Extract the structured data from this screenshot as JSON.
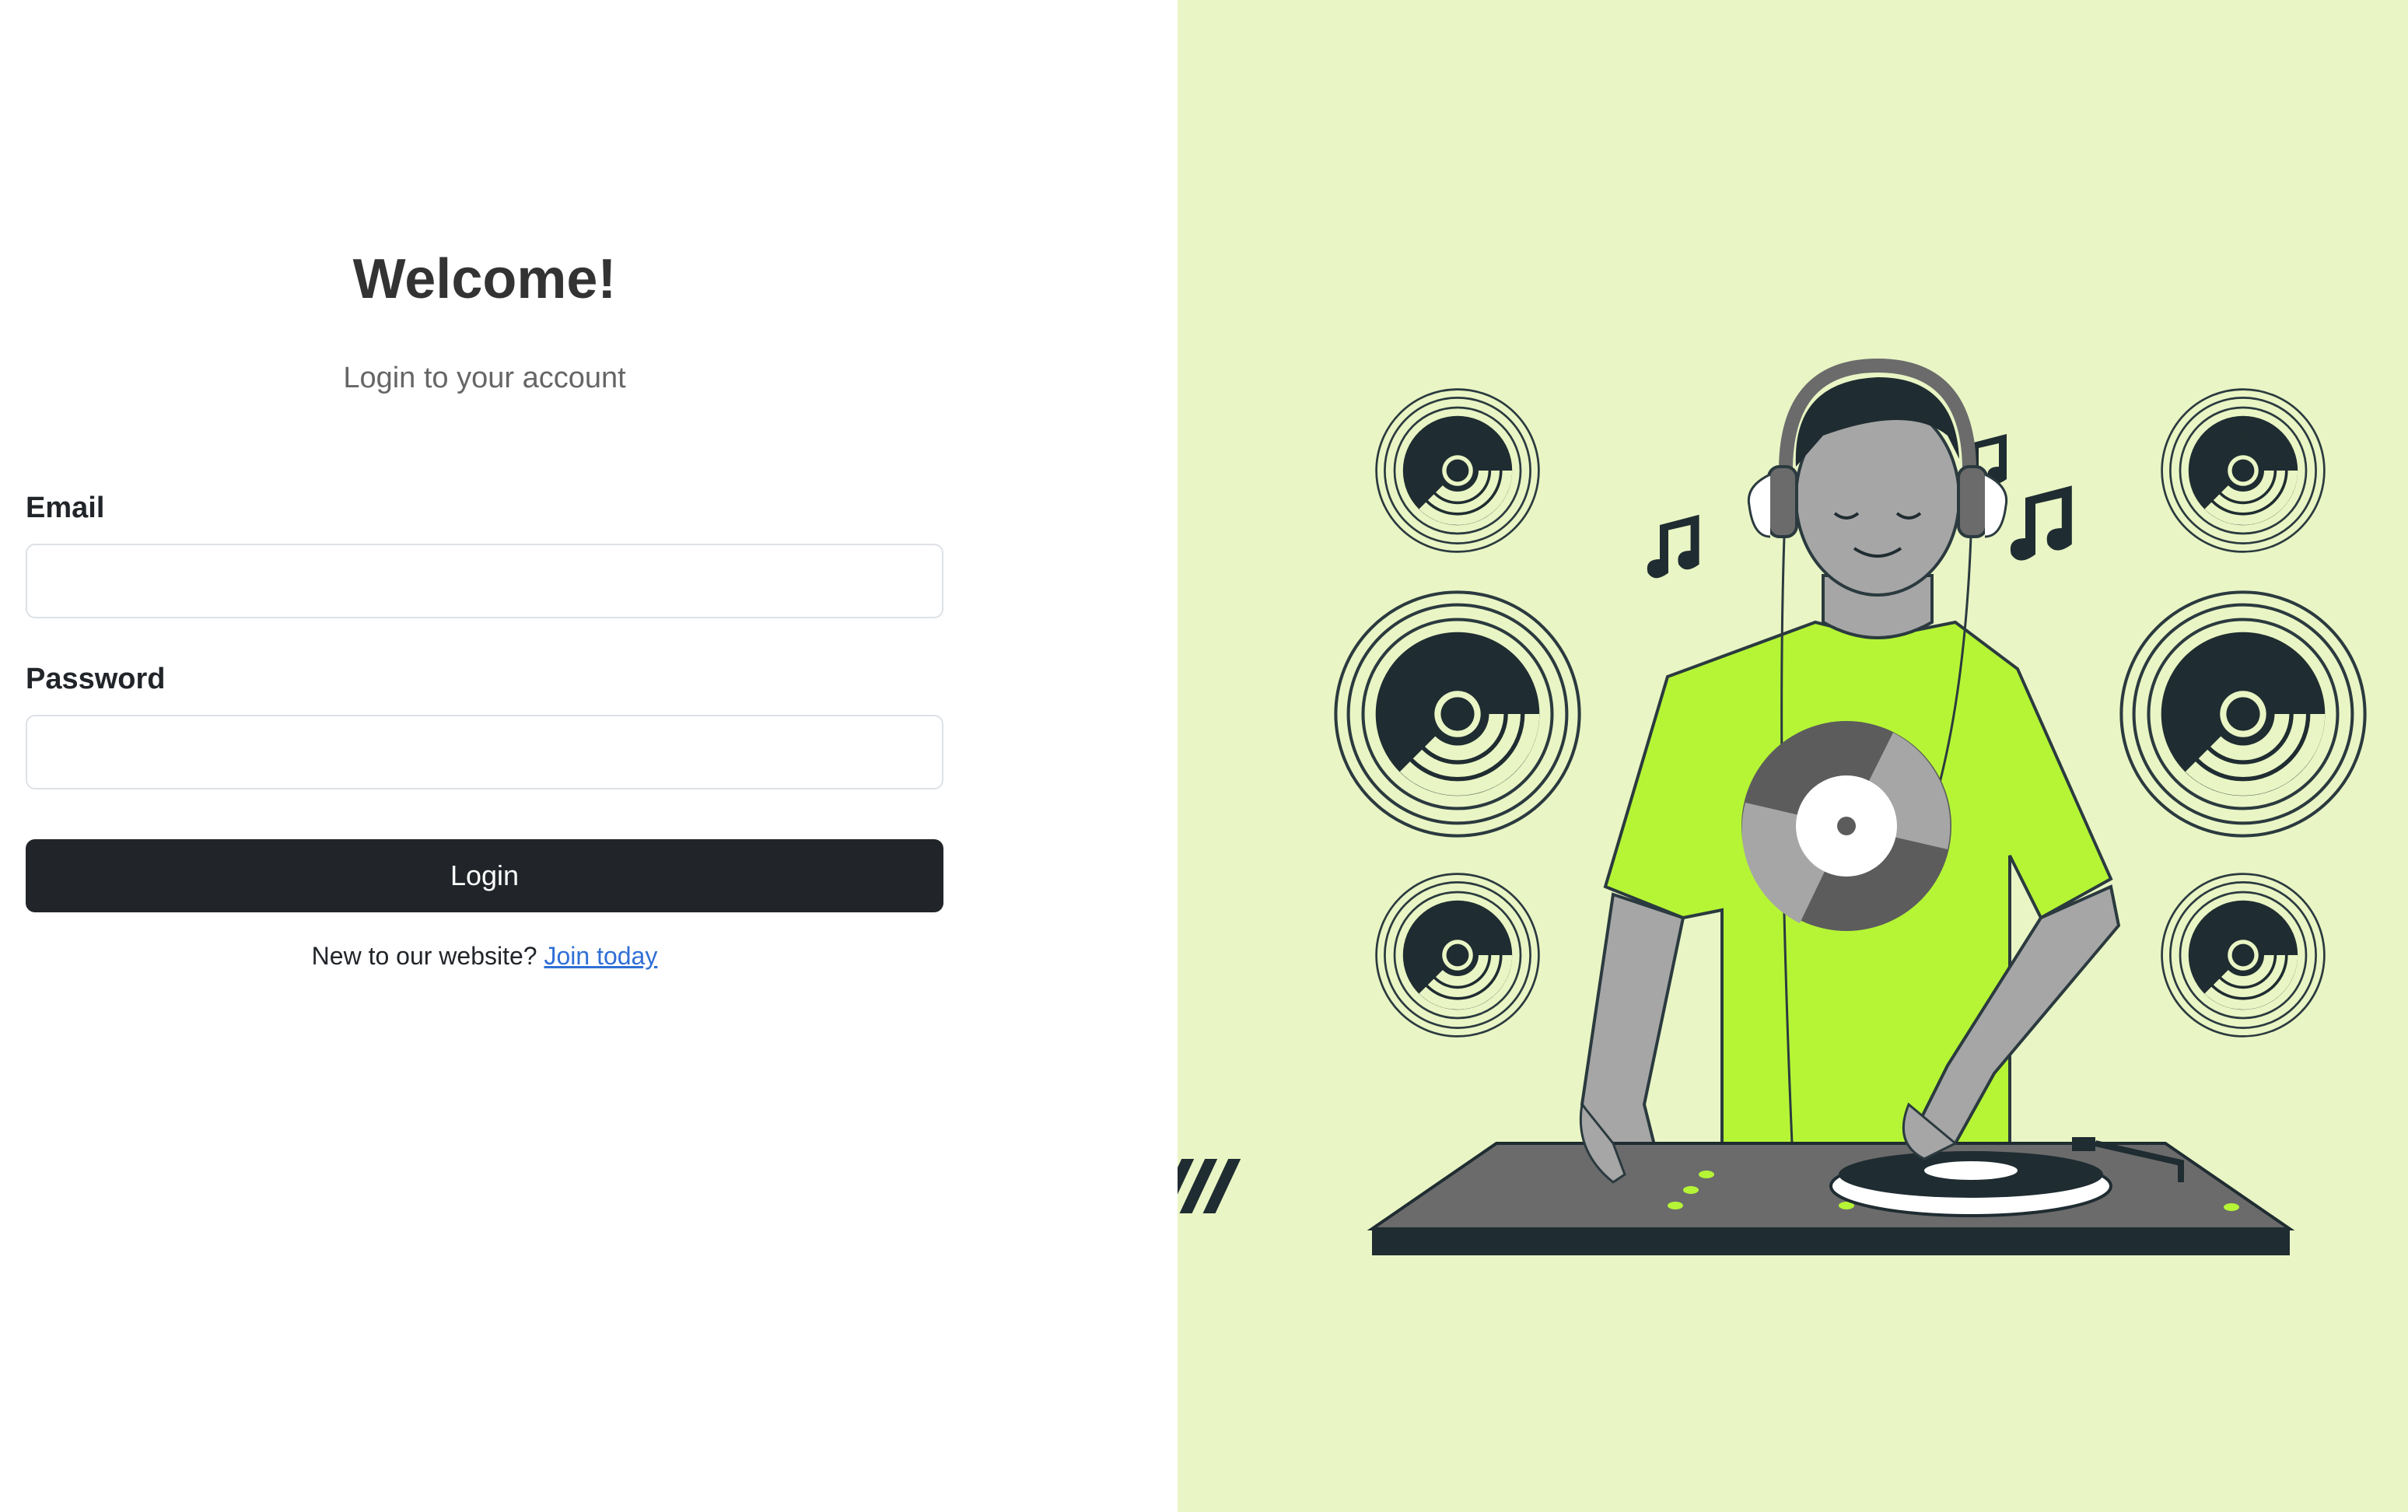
{
  "login": {
    "title": "Welcome!",
    "subtitle": "Login to your account",
    "email_label": "Email",
    "email_value": "",
    "password_label": "Password",
    "password_value": "",
    "login_button": "Login",
    "signup_prompt": "New to our website?",
    "signup_link": "Join today"
  },
  "colors": {
    "illustration_background": "#e9f5c4",
    "accent_green": "#b5f536",
    "button_dark": "#212529",
    "link_blue": "#2f6fd6"
  },
  "illustration": {
    "subject": "dj-with-headphones-at-turntable",
    "icons": [
      "speaker-icon",
      "music-note-icon",
      "vinyl-record-icon",
      "turntable-icon",
      "mixer-icon"
    ]
  }
}
